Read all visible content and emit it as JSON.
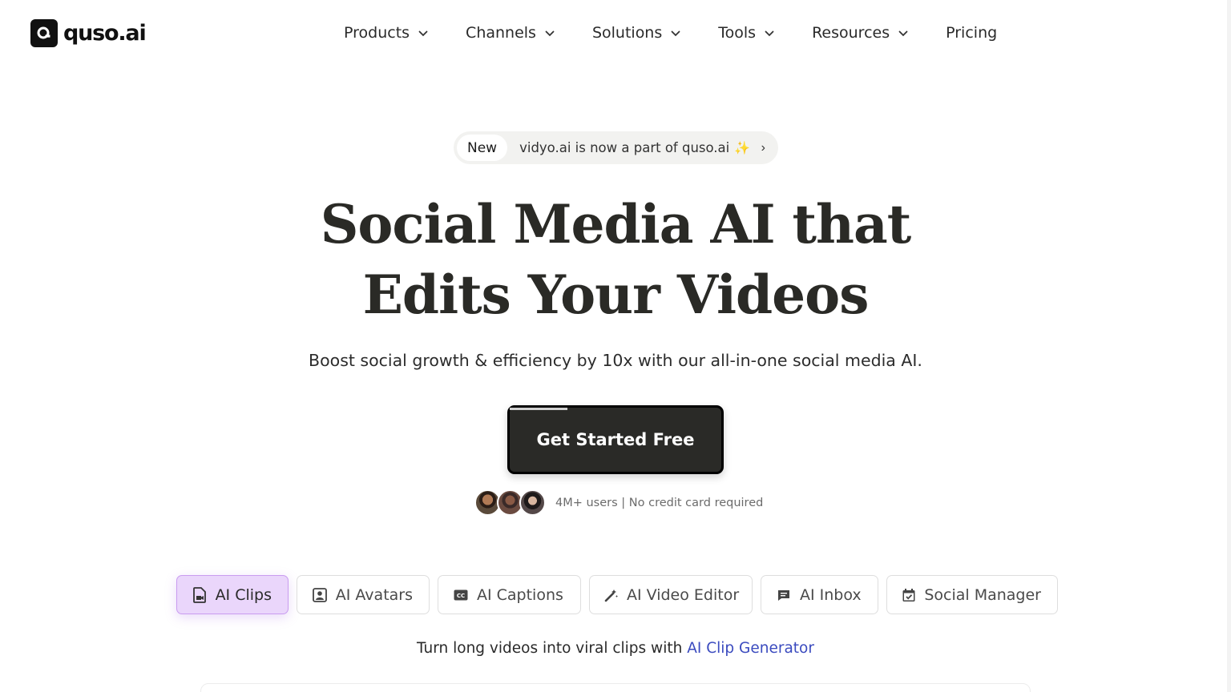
{
  "brand": {
    "name": "quso.ai"
  },
  "nav": {
    "items": [
      {
        "label": "Products",
        "has_dropdown": true
      },
      {
        "label": "Channels",
        "has_dropdown": true
      },
      {
        "label": "Solutions",
        "has_dropdown": true
      },
      {
        "label": "Tools",
        "has_dropdown": true
      },
      {
        "label": "Resources",
        "has_dropdown": true
      },
      {
        "label": "Pricing",
        "has_dropdown": false
      }
    ]
  },
  "announcement": {
    "badge": "New",
    "text": "vidyo.ai is now a part of quso.ai",
    "icon": "sparkle-icon",
    "arrow": "chevron-right-icon"
  },
  "hero": {
    "title_line1": "Social Media AI that",
    "title_line2": "Edits Your Videos",
    "subtitle": "Boost social growth & efficiency by 10x with our all-in-one social media AI.",
    "cta_label": "Get Started Free",
    "proof_users": "4M+ users",
    "proof_separator": "|",
    "proof_note": "No credit card required"
  },
  "tabs": [
    {
      "label": "AI Clips",
      "icon": "file-video-icon",
      "active": true
    },
    {
      "label": "AI Avatars",
      "icon": "portrait-icon",
      "active": false
    },
    {
      "label": "AI Captions",
      "icon": "cc-icon",
      "active": false
    },
    {
      "label": "AI Video Editor",
      "icon": "magic-wand-icon",
      "active": false
    },
    {
      "label": "AI Inbox",
      "icon": "chat-icon",
      "active": false
    },
    {
      "label": "Social Manager",
      "icon": "calendar-check-icon",
      "active": false
    }
  ],
  "tagline": {
    "text": "Turn long videos into viral clips with",
    "link": "AI Clip Generator"
  },
  "colors": {
    "cta_bg": "#2a2a27",
    "active_tab_bg": "#ead6fb",
    "active_tab_border": "#c99cf0",
    "link": "#3b4bbf",
    "sparkle": "#f5b400"
  }
}
